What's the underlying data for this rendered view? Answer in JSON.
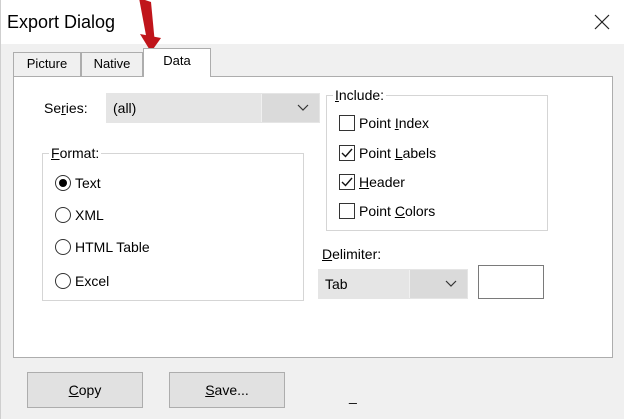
{
  "window": {
    "title": "Export Dialog"
  },
  "tabs": [
    {
      "label": "Picture",
      "active": false
    },
    {
      "label": "Native",
      "active": false
    },
    {
      "label": "Data",
      "active": true
    }
  ],
  "series": {
    "label_pre": "Se",
    "label_accel": "r",
    "label_post": "ies:",
    "value": "(all)"
  },
  "format": {
    "title_accel": "F",
    "title_post": "ormat:",
    "options": [
      {
        "label": "Text",
        "selected": true
      },
      {
        "label": "XML",
        "selected": false
      },
      {
        "label": "HTML Table",
        "selected": false
      },
      {
        "label": "Excel",
        "selected": false
      }
    ]
  },
  "include": {
    "title_accel": "I",
    "title_post": "nclude:",
    "items": [
      {
        "pre": "Point ",
        "accel": "I",
        "post": "ndex",
        "checked": false
      },
      {
        "pre": "Point ",
        "accel": "L",
        "post": "abels",
        "checked": true
      },
      {
        "pre": "",
        "accel": "H",
        "post": "eader",
        "checked": true
      },
      {
        "pre": "Point ",
        "accel": "C",
        "post": "olors",
        "checked": false
      }
    ]
  },
  "delimiter": {
    "label_accel": "D",
    "label_post": "elimiter:",
    "value": "Tab",
    "custom_value": ""
  },
  "footer": {
    "copy_accel": "C",
    "copy_post": "opy",
    "save_accel": "S",
    "save_post": "ave...",
    "status_mark": "_"
  },
  "colors": {
    "pointer": "#c0151b",
    "panel_bg": "#ffffff",
    "dialog_bg": "#f0f0f0"
  },
  "icons": {
    "close": "close-icon",
    "dropdown": "chevron-down-icon"
  }
}
